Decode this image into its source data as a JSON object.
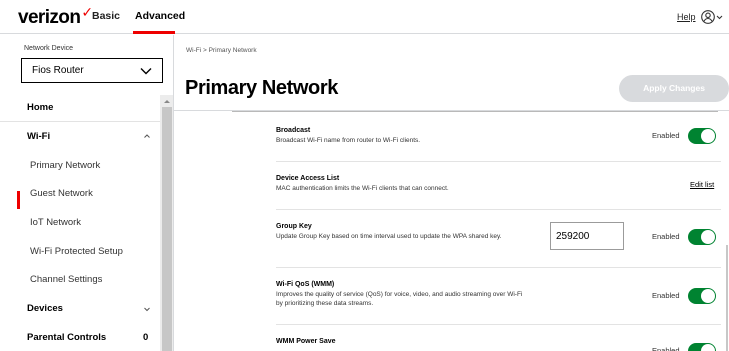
{
  "header": {
    "logo": "verizon",
    "logo_mark": "✓",
    "nav_basic": "Basic",
    "nav_advanced": "Advanced",
    "help": "Help"
  },
  "sidebar": {
    "network_device_label": "Network Device",
    "network_device_value": "Fios Router",
    "home": "Home",
    "wifi": "Wi-Fi",
    "wifi_items": [
      "Primary Network",
      "Guest Network",
      "IoT Network",
      "Wi-Fi Protected Setup",
      "Channel Settings"
    ],
    "devices": "Devices",
    "parental_controls": "Parental Controls",
    "parental_count": "0"
  },
  "main": {
    "breadcrumb": "Wi-Fi  >  Primary Network",
    "title": "Primary Network",
    "apply_button": "Apply Changes",
    "settings": {
      "broadcast": {
        "title": "Broadcast",
        "desc": "Broadcast Wi-Fi name from router to Wi-Fi clients.",
        "state": "Enabled"
      },
      "device_access": {
        "title": "Device Access List",
        "desc": "MAC authentication limits the Wi-Fi clients that can connect.",
        "link": "Edit list"
      },
      "group_key": {
        "title": "Group Key",
        "desc": "Update Group Key based on time interval used to update the WPA shared key.",
        "value": "259200",
        "state": "Enabled"
      },
      "wmm": {
        "title": "Wi-Fi QoS (WMM)",
        "desc": "Improves the quality of service (QoS) for voice, video, and audio streaming over Wi-Fi by prioritizing these data streams.",
        "state": "Enabled"
      },
      "wmm_power": {
        "title": "WMM Power Save",
        "state": "Enabled"
      }
    }
  },
  "colors": {
    "accent": "#ee0000",
    "toggle_on": "#008331",
    "apply_disabled": "#d8dadd"
  }
}
